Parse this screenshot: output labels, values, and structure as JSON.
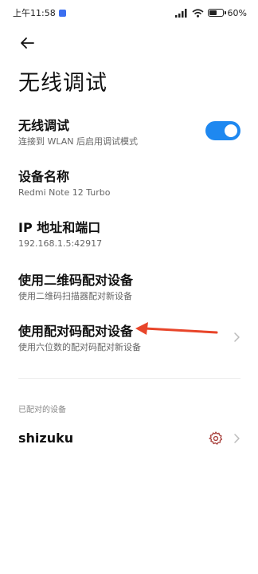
{
  "status_bar": {
    "time": "上午11:58",
    "battery_text": "60%",
    "battery_level": 0.6
  },
  "header": {
    "back_icon": "arrow-left-icon",
    "title": "无线调试"
  },
  "settings": {
    "wireless_debugging": {
      "title": "无线调试",
      "subtitle": "连接到 WLAN 后启用调试模式",
      "enabled": true
    },
    "device_name": {
      "title": "设备名称",
      "value": "Redmi Note 12 Turbo"
    },
    "ip_port": {
      "title": "IP 地址和端口",
      "value": "192.168.1.5:42917"
    },
    "pair_qr": {
      "title": "使用二维码配对设备",
      "subtitle": "使用二维码扫描器配对新设备"
    },
    "pair_code": {
      "title": "使用配对码配对设备",
      "subtitle": "使用六位数的配对码配对新设备"
    }
  },
  "paired_devices": {
    "header": "已配对的设备",
    "items": [
      {
        "name": "shizuku"
      }
    ]
  },
  "colors": {
    "accent": "#1e88f0",
    "annotation_arrow": "#e8452a",
    "gear_icon": "#a9423e"
  }
}
